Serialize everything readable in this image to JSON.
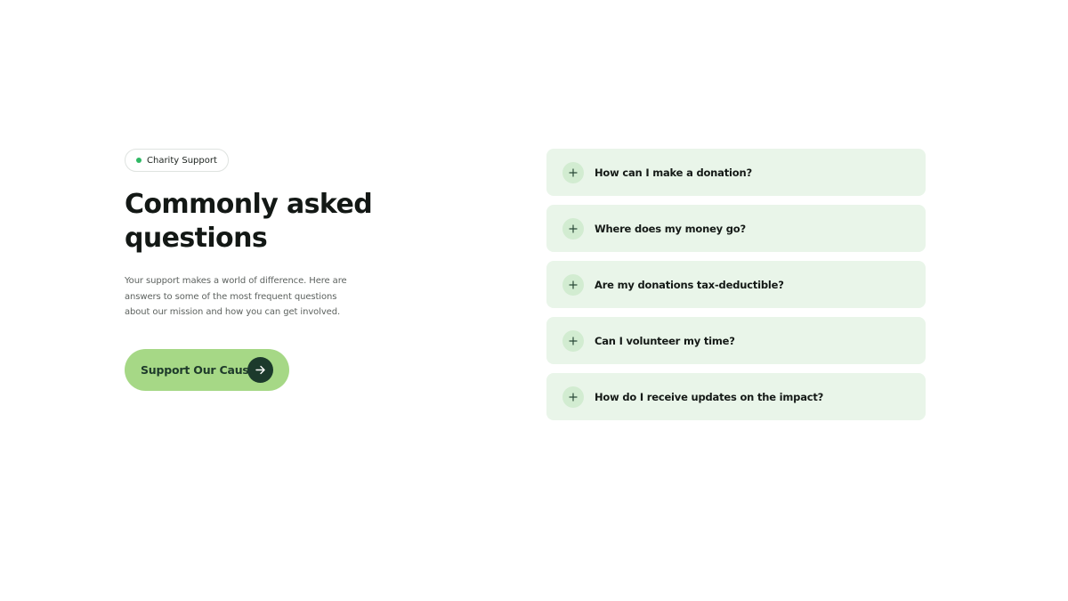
{
  "badge": {
    "label": "Charity Support"
  },
  "heading": {
    "line1": "Commonly asked",
    "line2": "questions"
  },
  "description": "Your support makes a world of difference. Here are answers to some of the most frequent questions about our mission and how you can get involved.",
  "cta": {
    "label": "Support Our Cause",
    "icon": "arrow-right-icon"
  },
  "faq": {
    "items": [
      {
        "question": "How can I make a donation?",
        "icon": "plus-icon"
      },
      {
        "question": "Where does my money go?",
        "icon": "plus-icon"
      },
      {
        "question": "Are my donations tax-deductible?",
        "icon": "plus-icon"
      },
      {
        "question": "Can I volunteer my time?",
        "icon": "plus-icon"
      },
      {
        "question": "How do I receive updates on the impact?",
        "icon": "plus-icon"
      }
    ]
  },
  "colors": {
    "accent_green": "#a6d886",
    "dark_green": "#1c3a2c",
    "faq_background": "#e9f5e9",
    "badge_dot": "#2fb864"
  }
}
